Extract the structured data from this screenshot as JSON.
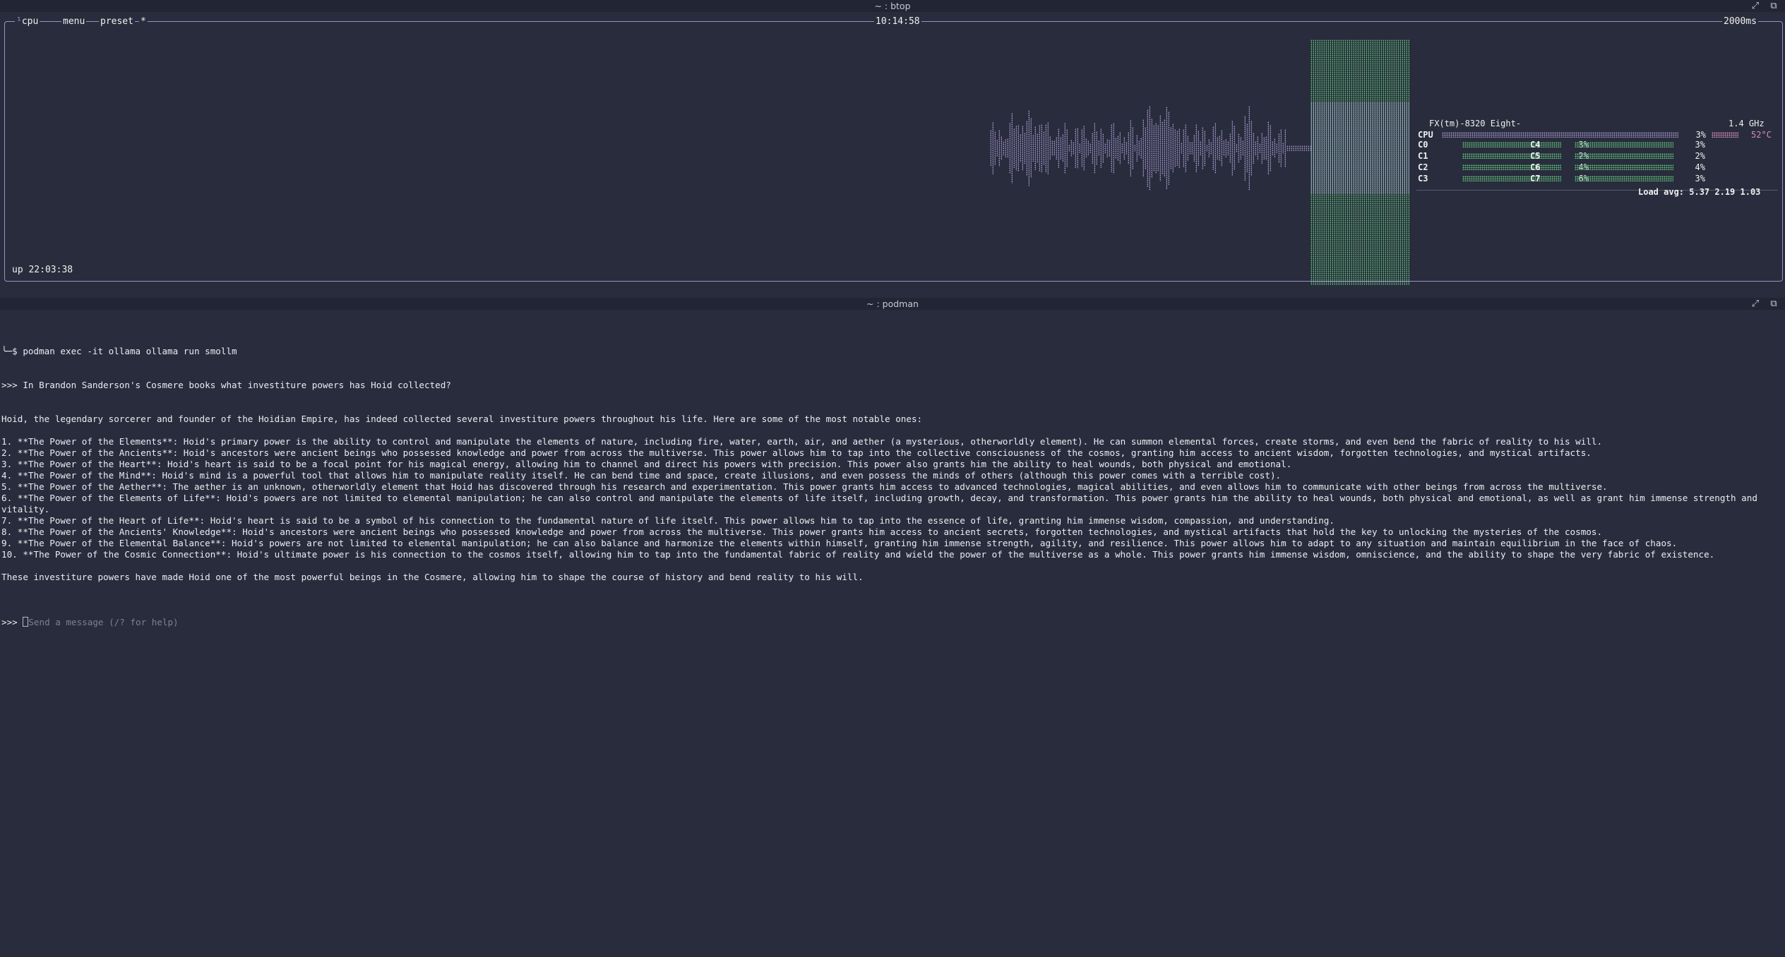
{
  "btop_window": {
    "title": "~ : btop",
    "label_cpu": "cpu",
    "label_menu": "menu",
    "label_preset": "preset",
    "label_star": "*",
    "clock": "10:14:58",
    "interval": "2000ms",
    "uptime": "up 22:03:38",
    "cpu_model": "FX(tm)-8320 Eight-",
    "freq": "1.4 GHz",
    "cpu_total": {
      "label": "CPU",
      "percent": "3%",
      "temp": "52°C"
    },
    "cores": [
      {
        "label": "C0",
        "percent": "3%"
      },
      {
        "label": "C1",
        "percent": "2%"
      },
      {
        "label": "C2",
        "percent": "4%"
      },
      {
        "label": "C3",
        "percent": "6%"
      },
      {
        "label": "C4",
        "percent": "3%"
      },
      {
        "label": "C5",
        "percent": "2%"
      },
      {
        "label": "C6",
        "percent": "4%"
      },
      {
        "label": "C7",
        "percent": "3%"
      }
    ],
    "load_avg": "Load avg: 5.37 2.19 1.03",
    "colors": {
      "border": "#9c8fc4",
      "graph_low": "#9c8fc4",
      "graph_high": "#5fbf79",
      "temp": "#d38fb5"
    }
  },
  "podman_window": {
    "title": "~ : podman",
    "command": "$ podman exec -it ollama ollama run smollm",
    "question": ">>> In Brandon Sanderson's Cosmere books what investiture powers has Hoid collected?",
    "lines": [
      "Hoid, the legendary sorcerer and founder of the Hoidian Empire, has indeed collected several investiture powers throughout his life. Here are some of the most notable ones:",
      "",
      "1. **The Power of the Elements**: Hoid's primary power is the ability to control and manipulate the elements of nature, including fire, water, earth, air, and aether (a mysterious, otherworldly element). He can summon elemental forces, create storms, and even bend the fabric of reality to his will.",
      "2. **The Power of the Ancients**: Hoid's ancestors were ancient beings who possessed knowledge and power from across the multiverse. This power allows him to tap into the collective consciousness of the cosmos, granting him access to ancient wisdom, forgotten technologies, and mystical artifacts.",
      "3. **The Power of the Heart**: Hoid's heart is said to be a focal point for his magical energy, allowing him to channel and direct his powers with precision. This power also grants him the ability to heal wounds, both physical and emotional.",
      "4. **The Power of the Mind**: Hoid's mind is a powerful tool that allows him to manipulate reality itself. He can bend time and space, create illusions, and even possess the minds of others (although this power comes with a terrible cost).",
      "5. **The Power of the Aether**: The aether is an unknown, otherworldly element that Hoid has discovered through his research and experimentation. This power grants him access to advanced technologies, magical abilities, and even allows him to communicate with other beings from across the multiverse.",
      "6. **The Power of the Elements of Life**: Hoid's powers are not limited to elemental manipulation; he can also control and manipulate the elements of life itself, including growth, decay, and transformation. This power grants him the ability to heal wounds, both physical and emotional, as well as grant him immense strength and vitality.",
      "7. **The Power of the Heart of Life**: Hoid's heart is said to be a symbol of his connection to the fundamental nature of life itself. This power allows him to tap into the essence of life, granting him immense wisdom, compassion, and understanding.",
      "8. **The Power of the Ancients' Knowledge**: Hoid's ancestors were ancient beings who possessed knowledge and power from across the multiverse. This power grants him access to ancient secrets, forgotten technologies, and mystical artifacts that hold the key to unlocking the mysteries of the cosmos.",
      "9. **The Power of the Elemental Balance**: Hoid's powers are not limited to elemental manipulation; he can also balance and harmonize the elements within himself, granting him immense strength, agility, and resilience. This power allows him to adapt to any situation and maintain equilibrium in the face of chaos.",
      "10. **The Power of the Cosmic Connection**: Hoid's ultimate power is his connection to the cosmos itself, allowing him to tap into the fundamental fabric of reality and wield the power of the multiverse as a whole. This power grants him immense wisdom, omniscience, and the ability to shape the very fabric of existence.",
      "",
      "These investiture powers have made Hoid one of the most powerful beings in the Cosmere, allowing him to shape the course of history and bend reality to his will."
    ],
    "prompt": ">>> ",
    "input_placeholder": "Send a message (/? for help)"
  },
  "icons": [
    "maximize-icon",
    "new-tab-icon"
  ]
}
